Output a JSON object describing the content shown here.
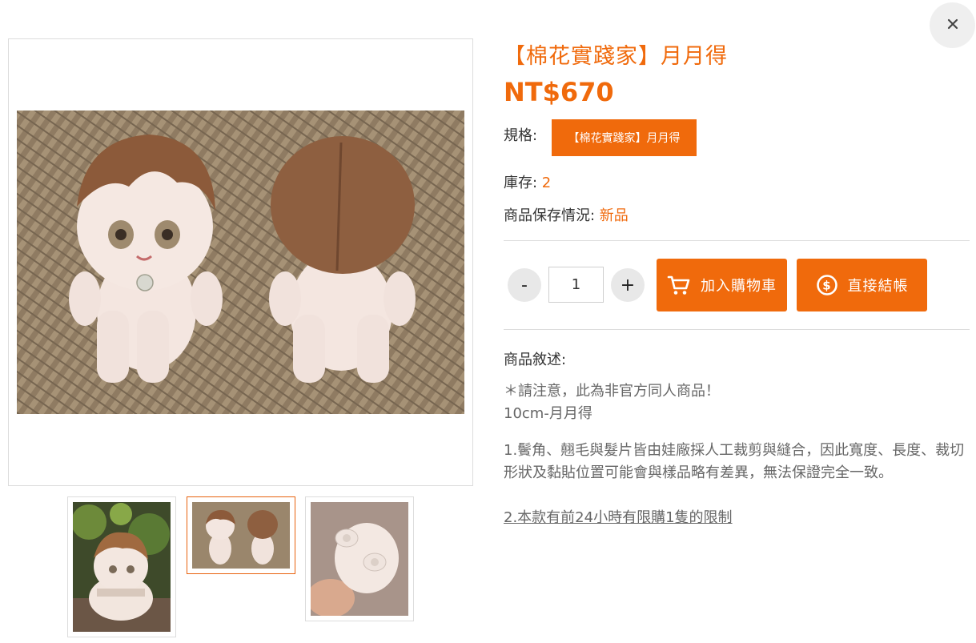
{
  "colors": {
    "accent": "#f06a0c",
    "border": "#dcdcdc",
    "text": "#333333",
    "muted": "#666666"
  },
  "close": {
    "icon": "close-icon"
  },
  "product": {
    "title": "【棉花實踐家】月月得",
    "price": "NT$670",
    "spec_label": "規格:",
    "spec_option": "【棉花實踐家】月月得",
    "stock_label": "庫存: ",
    "stock_value": "2",
    "condition_label": "商品保存情況: ",
    "condition_value": "新品"
  },
  "quantity": {
    "minus": "-",
    "plus": "+",
    "value": "1"
  },
  "actions": {
    "add_to_cart": "加入購物車",
    "add_to_cart_icon": "cart-icon",
    "checkout": "直接結帳",
    "checkout_icon": "dollar-coin-icon"
  },
  "description": {
    "label": "商品敘述:",
    "line1": "＊請注意，此為非官方同人商品！",
    "line2": "10cm-月月得",
    "paragraph": "1.鬢角、翹毛與髮片皆由娃廠採人工裁剪與縫合，因此寬度、長度、裁切形狀及黏貼位置可能會與樣品略有差異，無法保證完全一致。",
    "link": "2.本款有前24小時有限購1隻的限制"
  },
  "gallery": {
    "main_image": "plush-front-and-back-photo",
    "thumbnails": [
      "plush-sitting-outdoor-photo",
      "plush-front-and-back-photo",
      "plush-in-hand-photo"
    ],
    "active_index": 1
  }
}
